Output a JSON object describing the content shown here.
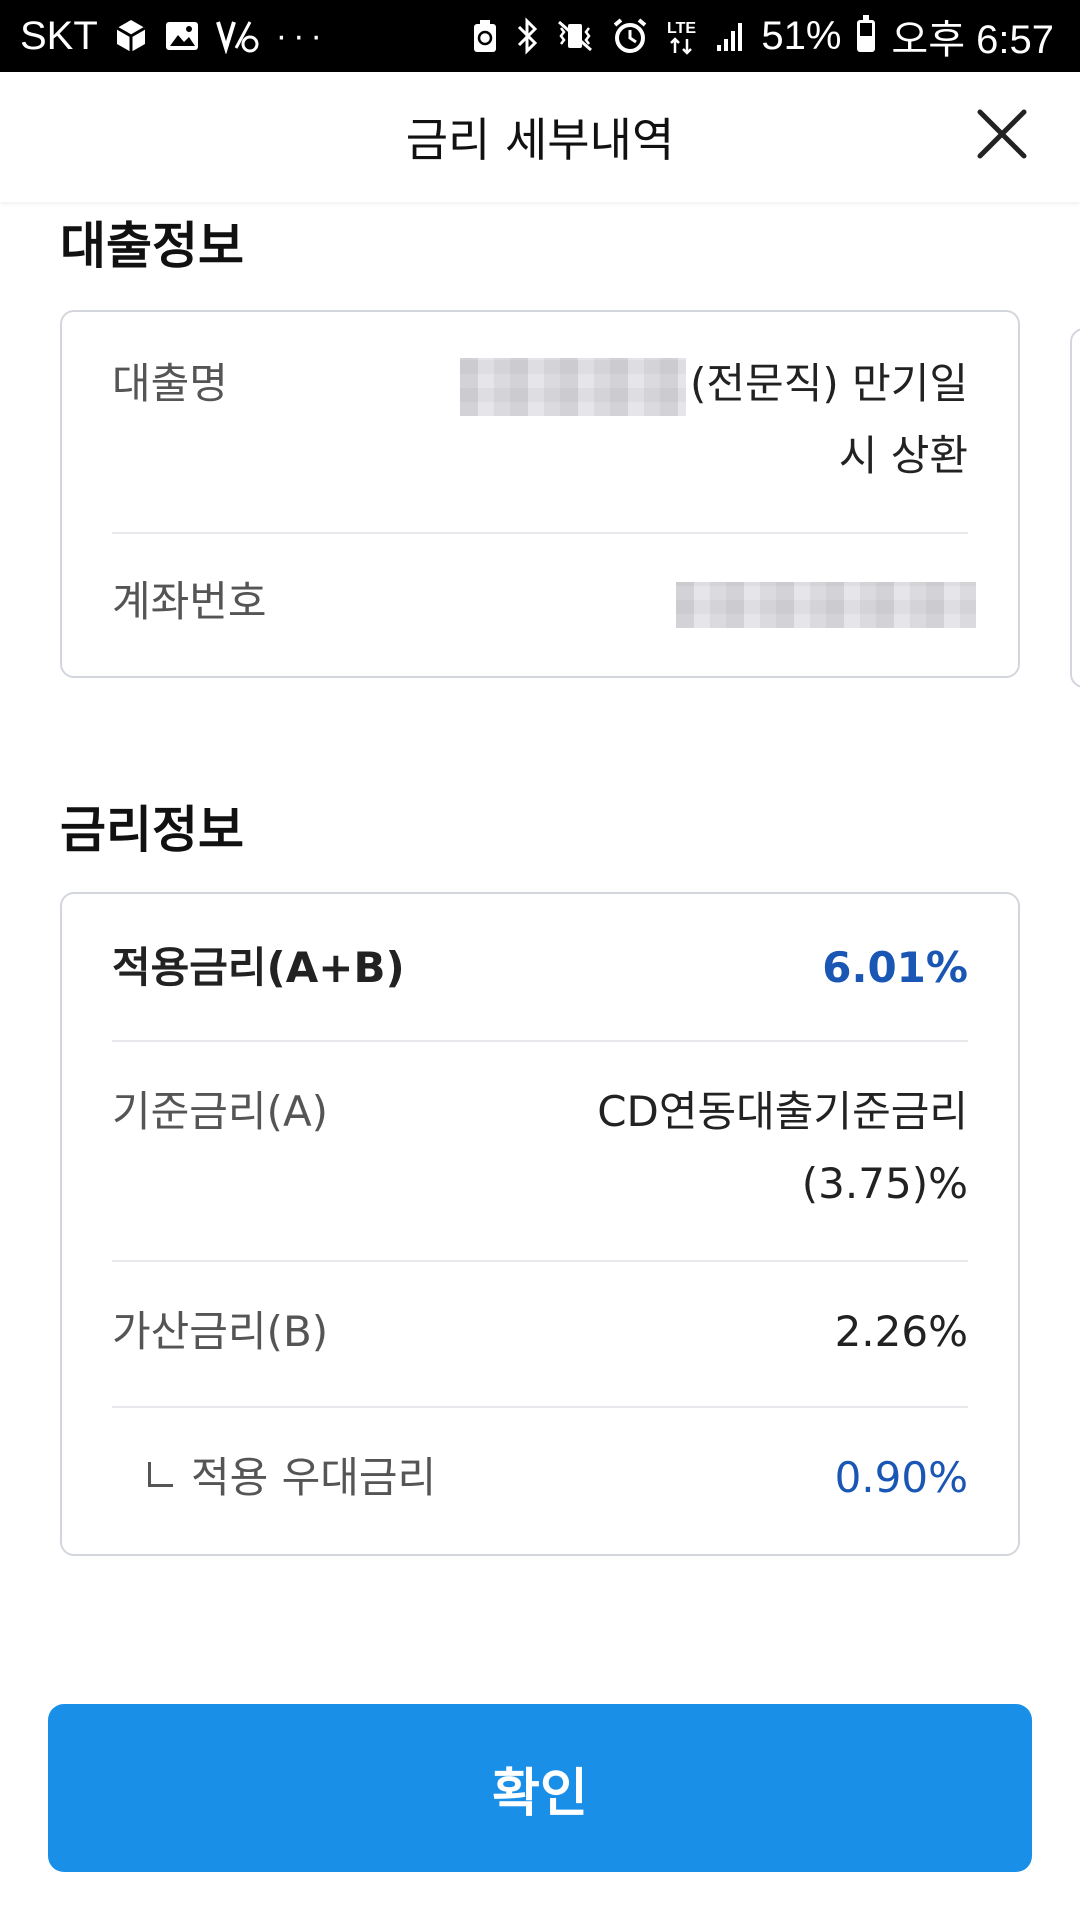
{
  "status_bar": {
    "carrier": "SKT",
    "more": "···",
    "network": "LTE",
    "battery_percent": "51%",
    "battery_level": 0.51,
    "time": "오후 6:57"
  },
  "header": {
    "title": "금리 세부내역",
    "close_icon": "close-icon"
  },
  "loan_info": {
    "title": "대출정보",
    "rows": [
      {
        "label": "대출명",
        "value_line1": "(전문직) 만기일",
        "value_line2": "시 상환"
      },
      {
        "label": "계좌번호"
      }
    ]
  },
  "rate_info": {
    "title": "금리정보",
    "applied": {
      "label": "적용금리(A+B)",
      "value": "6.01%"
    },
    "base": {
      "label": "기준금리(A)",
      "value_line1": "CD연동대출기준금리",
      "value_line2": "(3.75)%"
    },
    "spread": {
      "label": "가산금리(B)",
      "value": "2.26%"
    },
    "preferential": {
      "label": "적용 우대금리",
      "value": "0.90%"
    }
  },
  "confirm_button": {
    "label": "확인"
  },
  "colors": {
    "accent_blue": "#1a56b4",
    "button_blue": "#1a8fe8",
    "border": "#d3d7dd"
  }
}
